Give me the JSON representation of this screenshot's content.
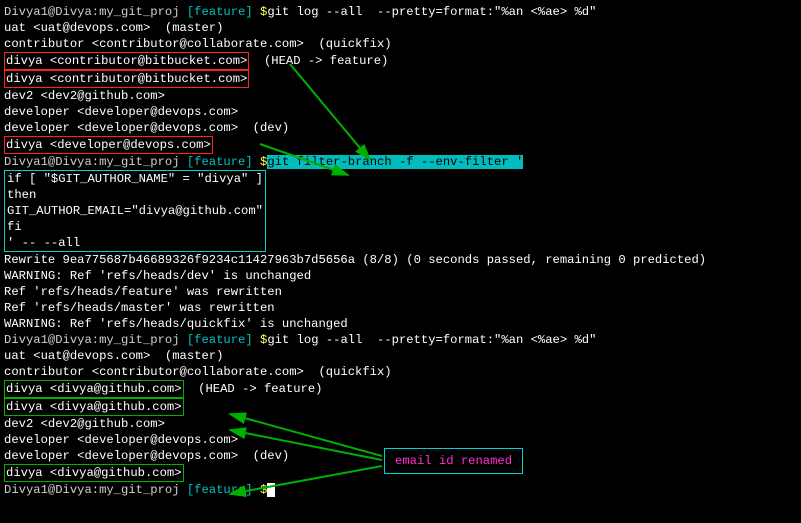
{
  "prompt1": {
    "userhost": "Divya1@Divya:my_git_proj ",
    "branch": "[feature] ",
    "dollar": "$",
    "cmd": "git log --all  --pretty=format:\"%an <%ae> %d\""
  },
  "log1": [
    "uat <uat@devops.com>  (master)",
    "contributor <contributor@collaborate.com>  (quickfix)"
  ],
  "log1_redA": "divya <contributor@bitbucket.com>",
  "log1_redA_tail": "  (HEAD -> feature)",
  "log1_redB": "divya <contributor@bitbucket.com>",
  "log1_mid": [
    "dev2 <dev2@github.com>",
    "developer <developer@devops.com>",
    "developer <developer@devops.com>  (dev)"
  ],
  "log1_redC": "divya <developer@devops.com>",
  "prompt2": {
    "userhost": "Divya1@Divya:my_git_proj ",
    "branch": "[feature] ",
    "dollar": "$",
    "cmd_hl": "git filter-branch -f --env-filter '"
  },
  "filter_block": [
    "if [ \"$GIT_AUTHOR_NAME\" = \"divya\" ]",
    "then",
    "GIT_AUTHOR_EMAIL=\"divya@github.com\"",
    "fi",
    "' -- --all"
  ],
  "rewrite": "Rewrite 9ea775687b46689326f9234c11427963b7d5656a (8/8) (0 seconds passed, remaining 0 predicted)",
  "warnings": [
    "WARNING: Ref 'refs/heads/dev' is unchanged",
    "Ref 'refs/heads/feature' was rewritten",
    "Ref 'refs/heads/master' was rewritten",
    "WARNING: Ref 'refs/heads/quickfix' is unchanged"
  ],
  "prompt3": {
    "userhost": "Divya1@Divya:my_git_proj ",
    "branch": "[feature] ",
    "dollar": "$",
    "cmd": "git log --all  --pretty=format:\"%an <%ae> %d\""
  },
  "log2_top": [
    "uat <uat@devops.com>  (master)",
    "contributor <contributor@collaborate.com>  (quickfix)"
  ],
  "log2_greenA": "divya <divya@github.com>",
  "log2_greenA_tail": "  (HEAD -> feature)",
  "log2_greenB": "divya <divya@github.com>",
  "log2_mid": [
    "dev2 <dev2@github.com>",
    "developer <developer@devops.com>",
    "developer <developer@devops.com>  (dev)"
  ],
  "log2_greenC": "divya <divya@github.com>",
  "prompt4": {
    "userhost": "Divya1@Divya:my_git_proj ",
    "branch": "[feature] ",
    "dollar": "$"
  },
  "annotation": {
    "label": "email id renamed"
  }
}
